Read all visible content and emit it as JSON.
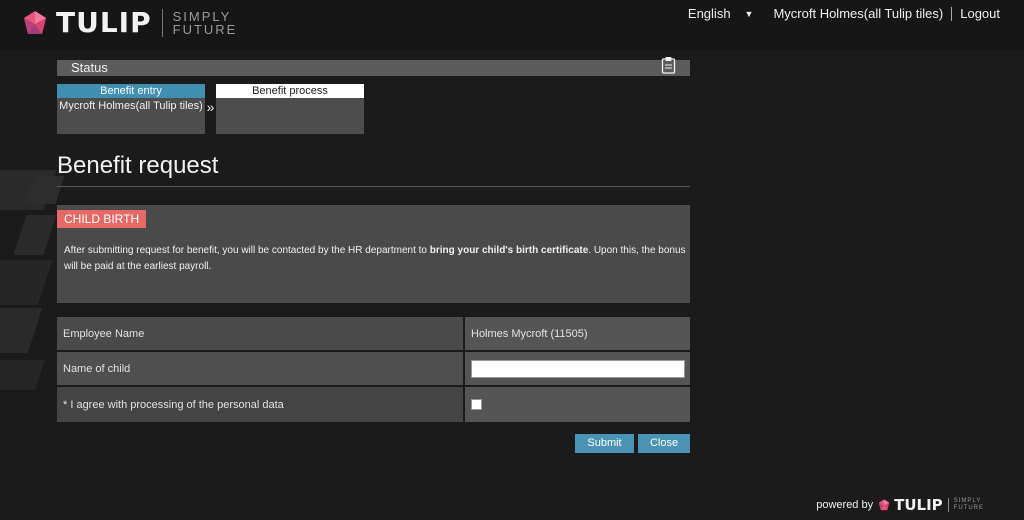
{
  "header": {
    "brand": "TULIP",
    "tagline_line1": "SIMPLY",
    "tagline_line2": "FUTURE",
    "language": "English",
    "user": "Mycroft Holmes(all Tulip tiles)",
    "logout": "Logout"
  },
  "status": {
    "title": "Status",
    "steps": [
      {
        "label": "Benefit entry",
        "sub": "Mycroft Holmes(all Tulip tiles)",
        "active": true
      },
      {
        "label": "Benefit process",
        "sub": "",
        "active": false
      }
    ],
    "chevron": "»"
  },
  "page": {
    "title": "Benefit request",
    "badge": "CHILD BIRTH",
    "info_before": "After submitting request for benefit, you will be contacted by the HR department to ",
    "info_bold": "bring your child's birth certificate",
    "info_after": ". Upon this, the bonus will be paid at the earliest payroll."
  },
  "form": {
    "employee_label": "Employee Name",
    "employee_value": "Holmes Mycroft (11505)",
    "child_label": "Name of child",
    "child_value": "",
    "consent_label": "* I agree with processing of the personal data",
    "consent_checked": false
  },
  "actions": {
    "submit": "Submit",
    "close": "Close"
  },
  "footer": {
    "powered_by": "powered by",
    "brand": "TULIP",
    "tagline_line1": "SIMPLY",
    "tagline_line2": "FUTURE"
  },
  "colors": {
    "accent": "#4a93b4",
    "active_step": "#3f8fb0",
    "badge": "#e56a65"
  }
}
